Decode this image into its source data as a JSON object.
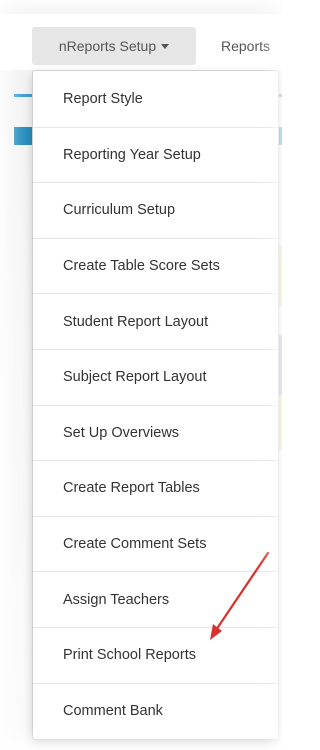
{
  "nav": {
    "setup_button_label": "nReports Setup",
    "reports_link_label": "Reports"
  },
  "menu": {
    "items": [
      {
        "label": "Report Style"
      },
      {
        "label": "Reporting Year Setup"
      },
      {
        "label": "Curriculum Setup"
      },
      {
        "label": "Create Table Score Sets"
      },
      {
        "label": "Student Report Layout"
      },
      {
        "label": "Subject Report Layout"
      },
      {
        "label": "Set Up Overviews"
      },
      {
        "label": "Create Report Tables"
      },
      {
        "label": "Create Comment Sets"
      },
      {
        "label": "Assign Teachers"
      },
      {
        "label": "Print School Reports"
      },
      {
        "label": "Comment Bank"
      }
    ]
  },
  "annotation": {
    "arrow_icon": "red-arrow-icon",
    "color": "#d9312b"
  },
  "colors": {
    "accent_blue": "#3fa0d8",
    "accent_teal": "#2a8fbf"
  }
}
